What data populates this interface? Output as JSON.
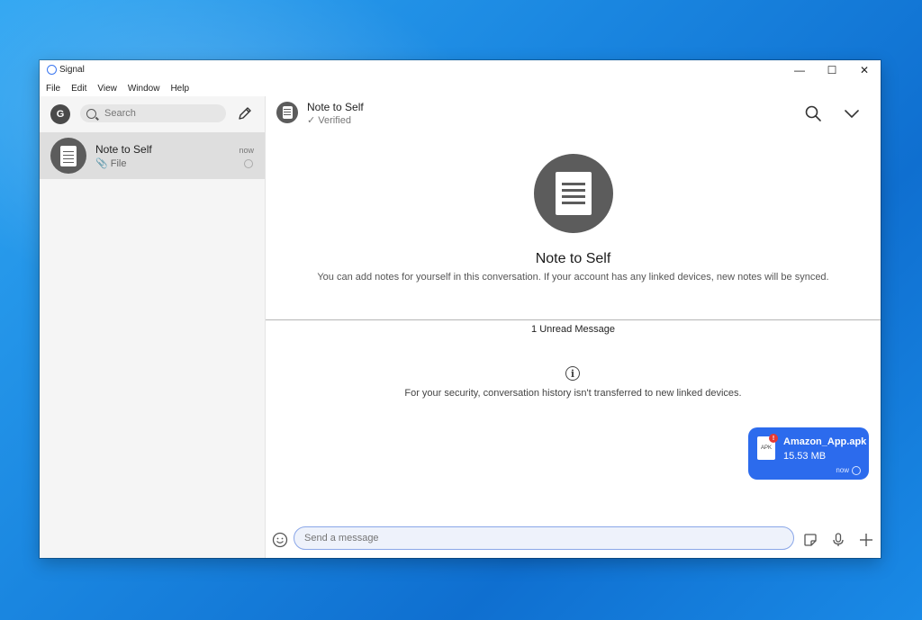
{
  "window": {
    "title": "Signal",
    "controls": {
      "minimize": "—",
      "maximize": "☐",
      "close": "✕"
    }
  },
  "menu": [
    "File",
    "Edit",
    "View",
    "Window",
    "Help"
  ],
  "sidebar": {
    "user_initial": "G",
    "search_placeholder": "Search",
    "conversations": [
      {
        "name": "Note to Self",
        "preview": "📎 File",
        "time": "now"
      }
    ]
  },
  "conversation_header": {
    "name": "Note to Self",
    "status": "✓ Verified"
  },
  "hero": {
    "title": "Note to Self",
    "subtitle": "You can add notes for yourself in this conversation. If your account has any linked devices, new notes will be synced."
  },
  "unread_divider": "1 Unread Message",
  "security_notice": "For your security, conversation history isn't transferred to new linked devices.",
  "message": {
    "file_type": "APK",
    "alert": "!",
    "file_name": "Amazon_App.apk",
    "file_size": "15.53 MB",
    "time": "now"
  },
  "composer": {
    "placeholder": "Send a message"
  },
  "colors": {
    "accent": "#2c6bed",
    "avatar": "#5c5c5c",
    "alert": "#e53935"
  }
}
